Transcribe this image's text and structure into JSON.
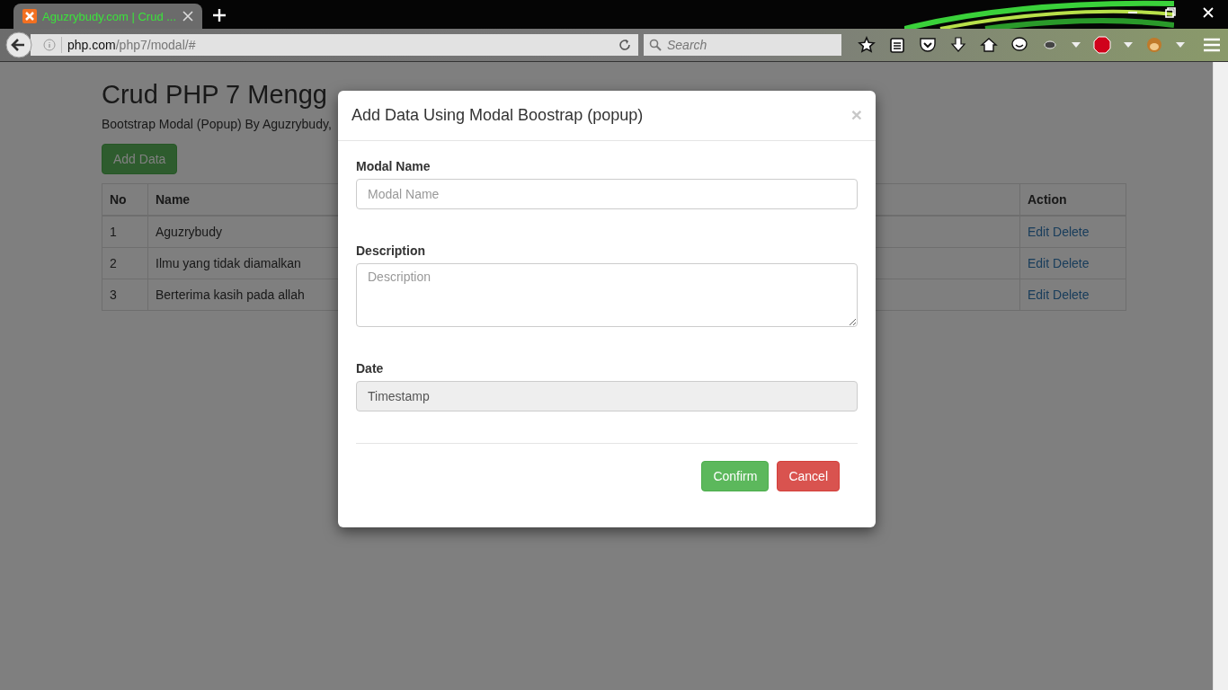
{
  "browser": {
    "tab": {
      "title": "Aguzrybudy.com | Crud ...",
      "selected": true
    },
    "url": {
      "host": "php.com",
      "path": "/php7/modal/#"
    },
    "search": {
      "placeholder": "Search"
    }
  },
  "page": {
    "title": "Crud PHP 7 Mengg",
    "subtitle": "Bootstrap Modal (Popup) By Aguzrybudy,",
    "add_button": "Add Data",
    "table": {
      "columns": [
        "No",
        "Name",
        "Action"
      ],
      "rows": [
        {
          "no": "1",
          "name": "Aguzrybudy",
          "actions": [
            "Edit",
            "Delete"
          ]
        },
        {
          "no": "2",
          "name": "Ilmu yang tidak diamalkan",
          "actions": [
            "Edit",
            "Delete"
          ]
        },
        {
          "no": "3",
          "name": "Berterima kasih pada allah",
          "actions": [
            "Edit",
            "Delete"
          ]
        }
      ]
    }
  },
  "modal": {
    "title": "Add Data Using Modal Boostrap (popup)",
    "close": "×",
    "fields": [
      {
        "kind": "text",
        "label": "Modal Name",
        "placeholder": "Modal Name",
        "disabled": false
      },
      {
        "kind": "textarea",
        "label": "Description",
        "placeholder": "Description",
        "disabled": false
      },
      {
        "kind": "text",
        "label": "Date",
        "value": "Timestamp",
        "disabled": true
      }
    ],
    "buttons": [
      {
        "label": "Confirm",
        "kind": "success"
      },
      {
        "label": "Cancel",
        "kind": "danger"
      }
    ]
  }
}
